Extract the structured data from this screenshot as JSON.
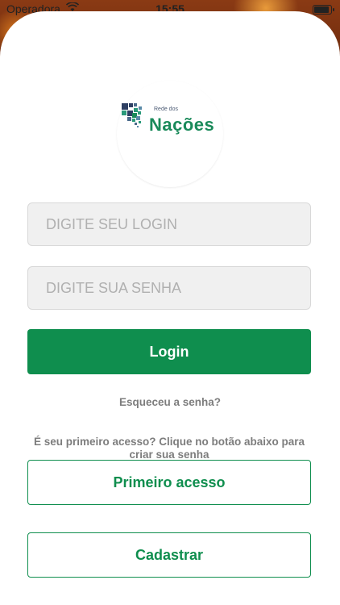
{
  "status_bar": {
    "carrier": "Operadora",
    "wifi_icon": "wifi-icon",
    "time": "15:55",
    "battery_icon": "battery-icon"
  },
  "logo": {
    "small_text": "Rede dos",
    "big_text": "Nações",
    "colors": {
      "green": "#1a8a5a",
      "navy": "#2e3f63",
      "teal": "#2a9a7a"
    }
  },
  "form": {
    "login_placeholder": "DIGITE SEU LOGIN",
    "password_placeholder": "DIGITE SUA SENHA",
    "login_value": "",
    "password_value": ""
  },
  "buttons": {
    "login_label": "Login",
    "forgot_label": "Esqueceu a senha?",
    "first_access_hint": "É seu primeiro acesso? Clique no botão abaixo para criar sua senha",
    "first_access_label": "Primeiro acesso",
    "register_label": "Cadastrar"
  },
  "colors": {
    "accent": "#0f8e4e",
    "muted_text": "#7d7d7d",
    "field_bg": "#f0f0f0"
  }
}
